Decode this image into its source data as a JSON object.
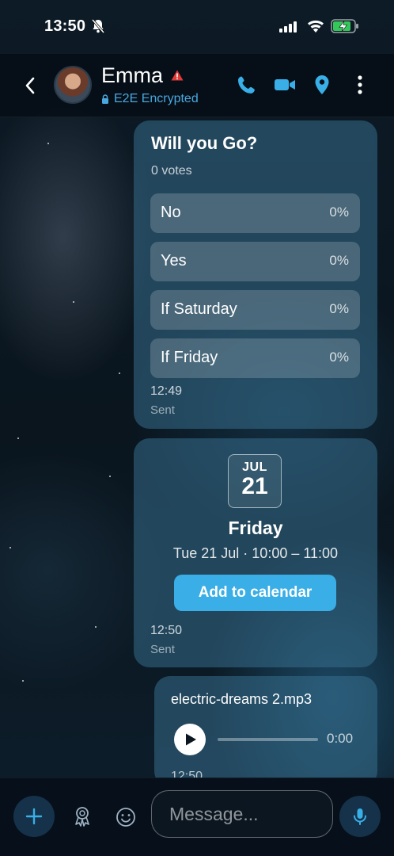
{
  "status_bar": {
    "time": "13:50"
  },
  "header": {
    "contact_name": "Emma",
    "encryption_label": "E2E Encrypted"
  },
  "poll": {
    "question": "Will you Go?",
    "votes": "0 votes",
    "options": [
      {
        "label": "No",
        "percent": "0%"
      },
      {
        "label": "Yes",
        "percent": "0%"
      },
      {
        "label": "If Saturday",
        "percent": "0%"
      },
      {
        "label": "If Friday",
        "percent": "0%"
      }
    ],
    "time": "12:49",
    "status": "Sent"
  },
  "event": {
    "month": "JUL",
    "day": "21",
    "title": "Friday",
    "when": "Tue 21 Jul · 10:00 – 11:00",
    "button_label": "Add to calendar",
    "time": "12:50",
    "status": "Sent"
  },
  "audio": {
    "file_name": "electric-dreams 2.mp3",
    "duration": "0:00",
    "progress": 0,
    "time": "12:50"
  },
  "composer": {
    "placeholder": "Message..."
  },
  "colors": {
    "accent": "#3aaee6",
    "encrypted_label": "#4aa8e0",
    "warning": "#e03a3a"
  }
}
